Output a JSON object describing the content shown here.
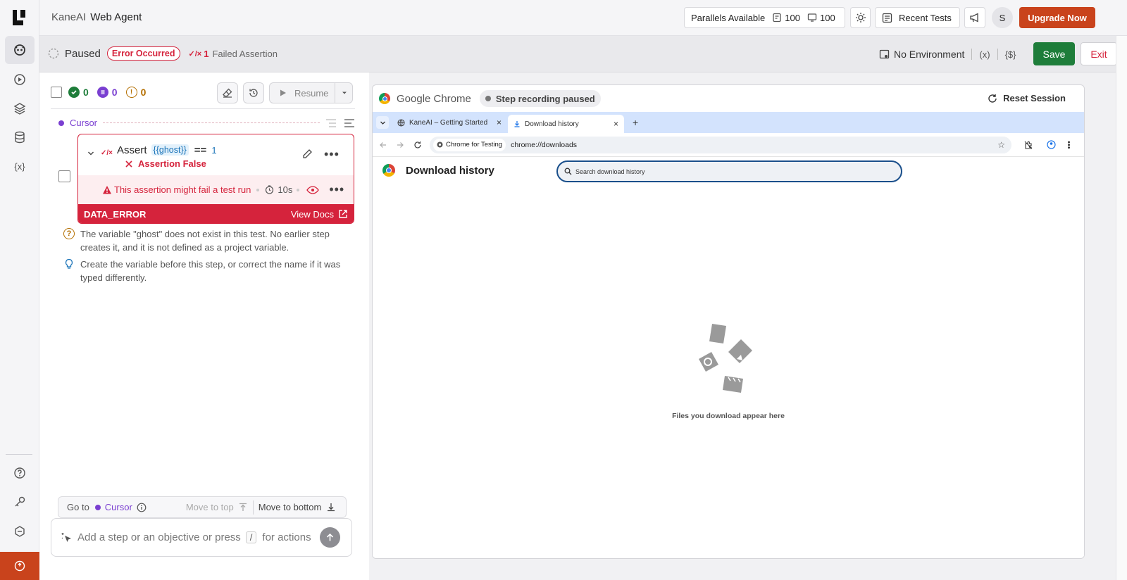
{
  "header": {
    "brand": "KaneAI",
    "product": "Web Agent",
    "parallels_label": "Parallels Available",
    "parallels_a": "100",
    "parallels_b": "100",
    "recent_tests": "Recent Tests",
    "avatar_initial": "S",
    "upgrade": "Upgrade Now"
  },
  "status": {
    "state": "Paused",
    "error_badge": "Error Occurred",
    "failed_count": "1",
    "failed_label": "Failed Assertion",
    "environment": "No Environment",
    "var_icon": "(x)",
    "secret_icon": "{$}",
    "save": "Save",
    "exit": "Exit"
  },
  "steps_toolbar": {
    "passed": "0",
    "pending": "0",
    "warnings": "0",
    "resume": "Resume"
  },
  "cursor_label": "Cursor",
  "step": {
    "action": "Assert",
    "variable": "{{ghost}}",
    "operator": "==",
    "value": "1",
    "result": "Assertion False",
    "warning": "This assertion might fail a test run",
    "duration": "10s",
    "error_code": "DATA_ERROR",
    "view_docs": "View Docs"
  },
  "diagnosis": {
    "problem": "The variable \"ghost\" does not exist in this test. No earlier step creates it, and it is not defined as a project variable.",
    "suggestion": "Create the variable before this step, or correct the name if it was typed differently."
  },
  "nav_bar": {
    "go_to": "Go to",
    "cursor": "Cursor",
    "move_top": "Move to top",
    "move_bottom": "Move to bottom"
  },
  "composer": {
    "placeholder": "Add a step or an objective or press",
    "key": "/",
    "suffix": "for actions"
  },
  "browser": {
    "app": "Google Chrome",
    "recording": "Step recording paused",
    "reset": "Reset Session",
    "tabs": [
      {
        "title": "KaneAI – Getting Started"
      },
      {
        "title": "Download history"
      }
    ],
    "site_chip": "Chrome for Testing",
    "url": "chrome://downloads",
    "page_title": "Download history",
    "search_placeholder": "Search download history",
    "empty_text": "Files you download appear here"
  },
  "colors": {
    "brand_orange": "#c9431c",
    "save_green": "#1e7d3a",
    "error_red": "#d5233c",
    "cursor_purple": "#7a3fd1",
    "tab_strip_blue": "#d3e3fd"
  }
}
